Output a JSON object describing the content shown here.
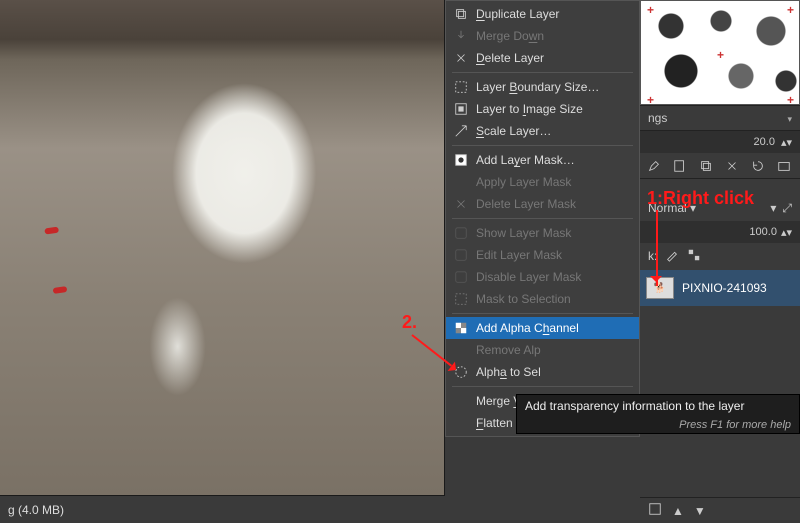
{
  "canvas": {
    "image_description": "White dog with red collar on cobblestone"
  },
  "status": {
    "memory": "g (4.0 MB)"
  },
  "context_menu": {
    "duplicate_layer": "Duplicate Layer",
    "merge_down": "Merge Down",
    "delete_layer": "Delete Layer",
    "layer_boundary_size": "Layer Boundary Size…",
    "layer_to_image_size": "Layer to Image Size",
    "scale_layer": "Scale Layer…",
    "add_layer_mask": "Add Layer Mask…",
    "apply_layer_mask": "Apply Layer Mask",
    "delete_layer_mask": "Delete Layer Mask",
    "show_layer_mask": "Show Layer Mask",
    "edit_layer_mask": "Edit Layer Mask",
    "disable_layer_mask": "Disable Layer Mask",
    "mask_to_selection": "Mask to Selection",
    "add_alpha_channel": "Add Alpha Channel",
    "remove_alpha_channel": "Remove Alp",
    "alpha_to_selection": "Alpha to Sel",
    "merge_visible_layers": "Merge Visible Layers…",
    "flatten_image": "Flatten Image"
  },
  "tooltip": {
    "text": "Add transparency information to the layer",
    "hint": "Press F1 for more help"
  },
  "right": {
    "property_label": "ngs",
    "spacing_value": "20.0",
    "mode_label": "Normal",
    "opacity_value": "100.0",
    "lock_label": "k:",
    "layer_name": "PIXNIO-241093"
  },
  "annotations": {
    "step1": "1:Right click",
    "step2": "2."
  }
}
